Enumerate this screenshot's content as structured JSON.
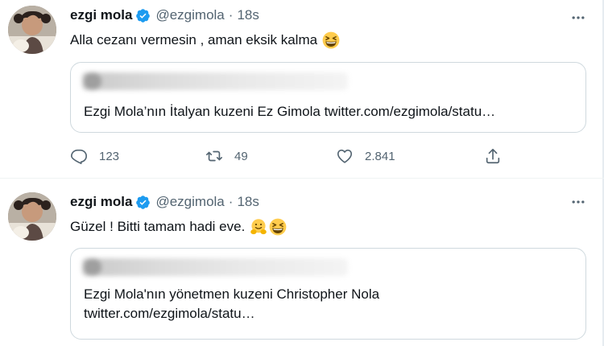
{
  "tweets": [
    {
      "author": {
        "name": "ezgi mola",
        "handle": "@ezgimola",
        "time": "18s",
        "separator": "·"
      },
      "text": "Alla cezanı vermesin , aman eksik kalma",
      "emojis": [
        "grinning-squinting-face"
      ],
      "quote": {
        "lines": [
          "Ezgi Mola’nın İtalyan kuzeni Ez Gimola twitter.com/ezgimola/statu…"
        ]
      },
      "stats": {
        "replies": "123",
        "retweets": "49",
        "likes": "2.841"
      }
    },
    {
      "author": {
        "name": "ezgi mola",
        "handle": "@ezgimola",
        "time": "18s",
        "separator": "·"
      },
      "text": "Güzel ! Bitti tamam hadi eve.",
      "emojis": [
        "hugging-face",
        "grinning-squinting-face"
      ],
      "quote": {
        "lines": [
          "Ezgi Mola'nın yönetmen kuzeni Christopher Nola",
          "twitter.com/ezgimola/statu…"
        ]
      }
    }
  ],
  "colors": {
    "verified": "#1d9bf0",
    "secondary_text": "#536471",
    "border": "#cfd9de",
    "emoji": "#ffcc4d"
  },
  "icons": [
    "verified-badge-icon",
    "more-icon",
    "reply-icon",
    "retweet-icon",
    "like-icon",
    "share-icon"
  ]
}
